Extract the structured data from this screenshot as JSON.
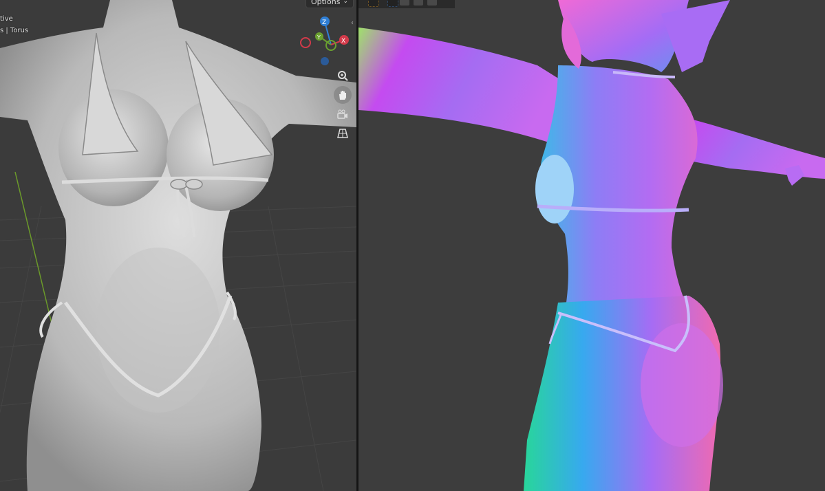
{
  "left_viewport": {
    "mode_text": "tive",
    "object_text": "s | Torus",
    "options_label": "Options",
    "gizmo": {
      "z_label": "Z",
      "y_label": "Y",
      "x_label": "X",
      "colors": {
        "z": "#2f7fd6",
        "y": "#6aa02f",
        "x": "#d33a4a"
      }
    },
    "nav_icons": [
      "zoom-icon",
      "hand-pan-icon",
      "camera-icon",
      "perspective-grid-icon"
    ]
  },
  "right_viewport": {
    "toolbar_icons": [
      "select-cursor-icon",
      "select-box-icon",
      "select-mode-icon",
      "select-mode-icon",
      "select-mode-icon"
    ]
  },
  "colors": {
    "viewport_bg": "#3b3b3b",
    "divider": "#151515",
    "model_grey": "#c9c9c9"
  }
}
